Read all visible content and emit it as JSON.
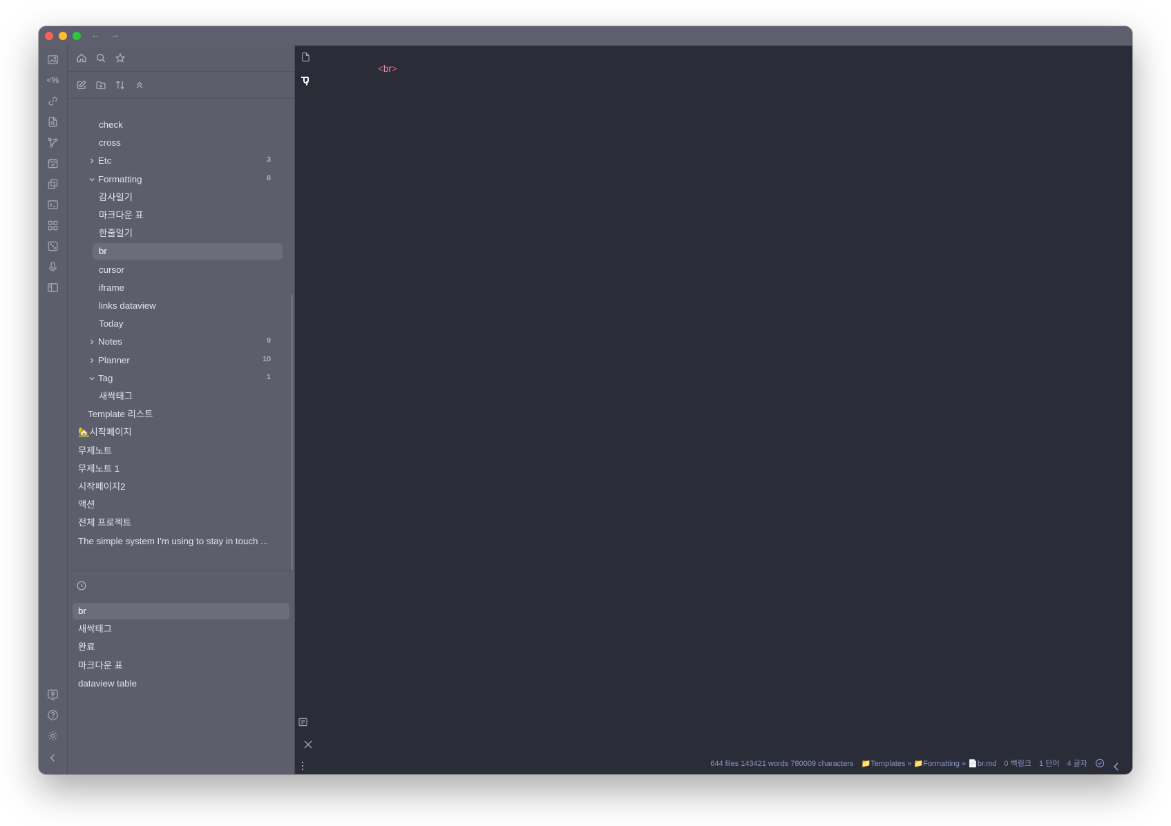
{
  "window": {
    "nav_back": "←",
    "nav_forward": "→"
  },
  "ribbon": {
    "icons": [
      "image-icon",
      "code-percent-icon",
      "link-icon",
      "file-search-icon",
      "graph-icon",
      "calendar-check-icon",
      "copy-icon",
      "terminal-icon",
      "grid-icon",
      "dice-icon",
      "microphone-icon",
      "sidebar-layout-icon",
      "vault-icon",
      "help-icon",
      "settings-icon",
      "collapse-icon"
    ],
    "percent_label": "<%"
  },
  "sidebar": {
    "tree": [
      {
        "label": "check",
        "depth": 2
      },
      {
        "label": "cross",
        "depth": 2
      },
      {
        "label": "Etc",
        "depth": 1,
        "folder": true,
        "open": false,
        "count": "3"
      },
      {
        "label": "Formatting",
        "depth": 1,
        "folder": true,
        "open": true,
        "count": "8"
      },
      {
        "label": "감사일기",
        "depth": 2
      },
      {
        "label": "마크다운 표",
        "depth": 2
      },
      {
        "label": "한줄일기",
        "depth": 2
      },
      {
        "label": "br",
        "depth": 2,
        "active": true
      },
      {
        "label": "cursor",
        "depth": 2
      },
      {
        "label": "iframe",
        "depth": 2
      },
      {
        "label": "links dataview",
        "depth": 2
      },
      {
        "label": "Today",
        "depth": 2
      },
      {
        "label": "Notes",
        "depth": 1,
        "folder": true,
        "open": false,
        "count": "9"
      },
      {
        "label": "Planner",
        "depth": 1,
        "folder": true,
        "open": false,
        "count": "10"
      },
      {
        "label": "Tag",
        "depth": 1,
        "folder": true,
        "open": true,
        "count": "1"
      },
      {
        "label": "새싹태그",
        "depth": 2
      },
      {
        "label": "Template 리스트",
        "depth": 0.5
      },
      {
        "label": "🏡시작페이지",
        "depth": 0
      },
      {
        "label": "무제노트",
        "depth": 0
      },
      {
        "label": "무제노트 1",
        "depth": 0
      },
      {
        "label": "시작페이지2",
        "depth": 0
      },
      {
        "label": "액션",
        "depth": 0
      },
      {
        "label": "전체 프로젝트",
        "depth": 0
      },
      {
        "label": "The simple system I'm using to stay in touch ...",
        "depth": 0
      }
    ],
    "recent": [
      {
        "label": "br",
        "active": true
      },
      {
        "label": "새싹태그"
      },
      {
        "label": "완료"
      },
      {
        "label": "마크다운 표"
      },
      {
        "label": "dataview table"
      }
    ]
  },
  "editor": {
    "code_open": "<",
    "code_tag": "br",
    "code_close": ">"
  },
  "status": {
    "stats": "644 files 143421 words 780009 characters",
    "breadcrumb": "📁Templates » 📁Formatting » 📄br.md",
    "backlinks": "0 백링크",
    "words": "1 단어",
    "chars": "4 글자"
  }
}
